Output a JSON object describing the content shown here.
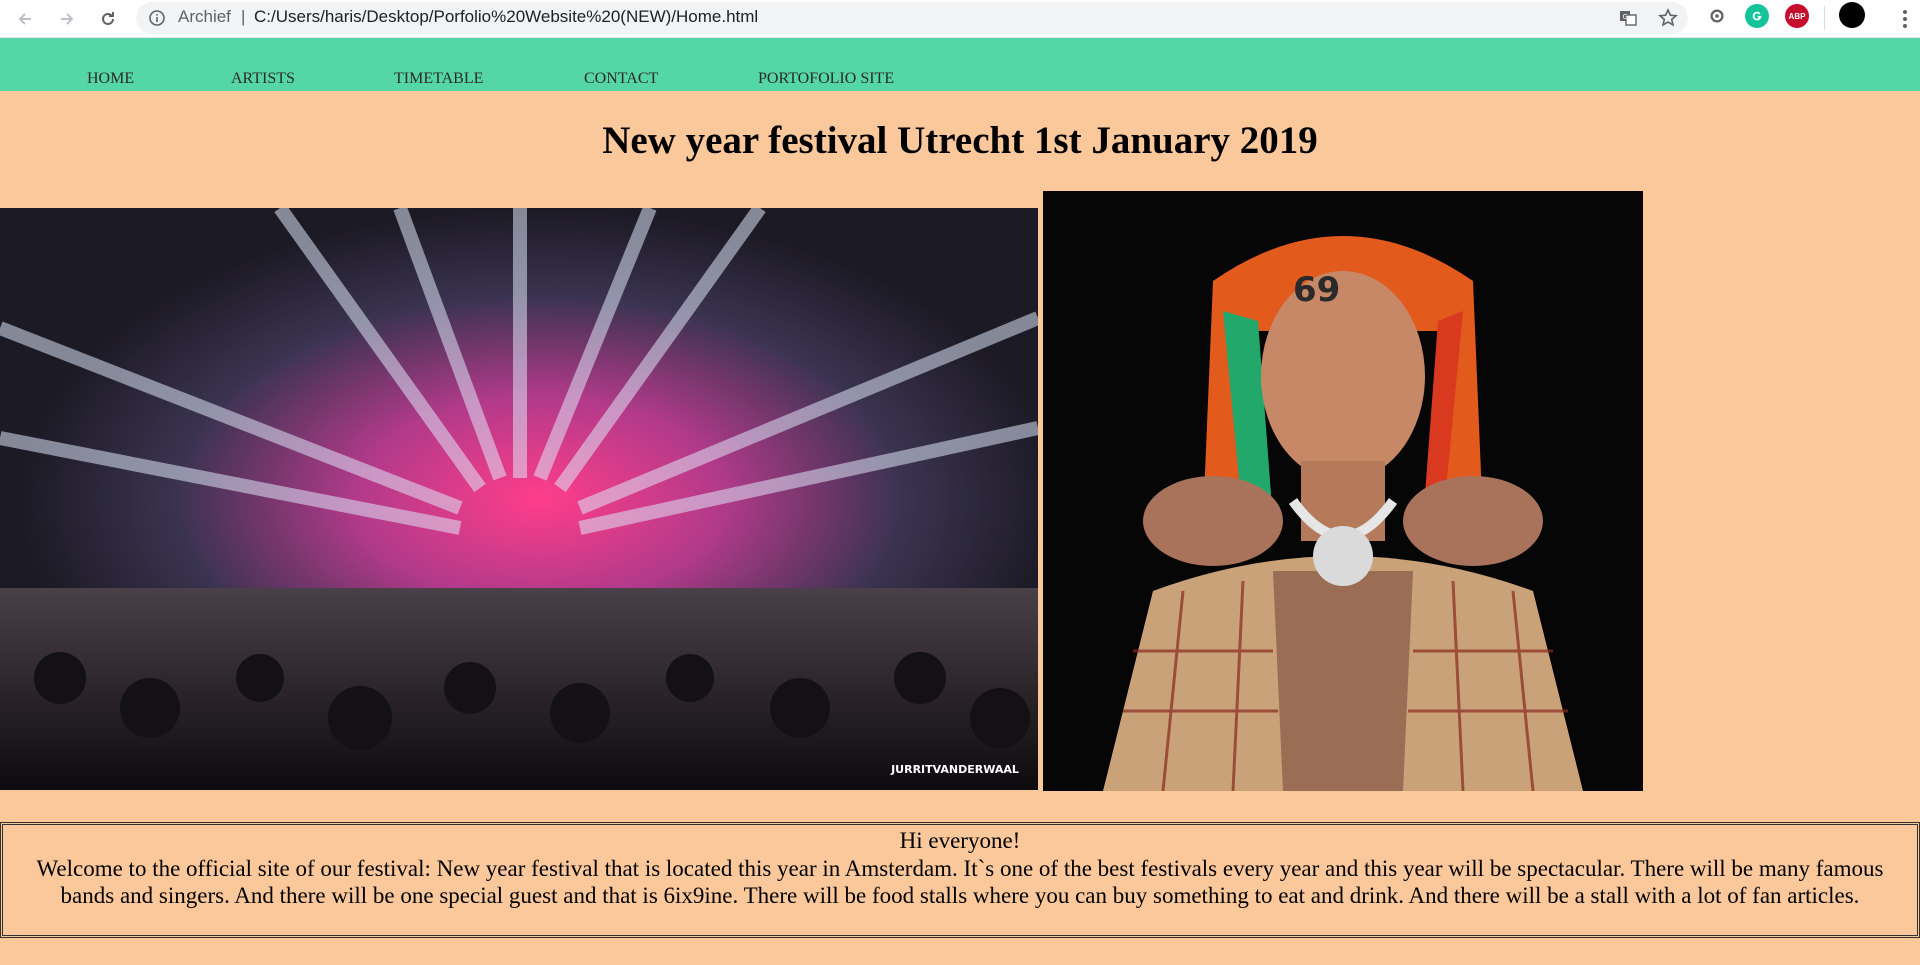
{
  "browser": {
    "site_chip": "Archief",
    "separator": "|",
    "url": "C:/Users/haris/Desktop/Porfolio%20Website%20(NEW)/Home.html",
    "extensions": [
      "translate-icon",
      "star-icon",
      "extension-icon",
      "grammarly-icon",
      "adblock-plus-icon",
      "profile-avatar",
      "menu-icon"
    ],
    "adblock_label": "ABP"
  },
  "nav": {
    "items": [
      {
        "label": "HOME"
      },
      {
        "label": "ARTISTS"
      },
      {
        "label": "TIMETABLE"
      },
      {
        "label": "CONTACT"
      },
      {
        "label": "PORTOFOLIO SITE"
      }
    ]
  },
  "page": {
    "title": "New year festival Utrecht 1st January 2019"
  },
  "images": {
    "festival_watermark": "JURRITVANDERWAAL",
    "artist_tattoo": "69"
  },
  "welcome": {
    "greeting": "Hi everyone!",
    "body": "Welcome to the official site of our festival: New year festival that is located this year in Amsterdam. It`s one of the best festivals every year and this year will be spectacular. There will be many famous bands and singers. And there will be one special guest and that is 6ix9ine. There will be food stalls where you can buy something to eat and drink. And there will be a stall with a lot of fan articles."
  },
  "colors": {
    "background": "#fbc89c",
    "nav_bar": "#55d6a8"
  }
}
